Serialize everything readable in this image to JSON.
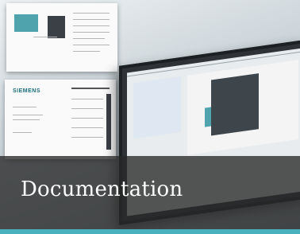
{
  "tile": {
    "caption": "Documentation"
  },
  "manual": {
    "brand": "SIEMENS"
  },
  "colors": {
    "accent": "#49b0bd",
    "caption_bg": "#282828"
  }
}
